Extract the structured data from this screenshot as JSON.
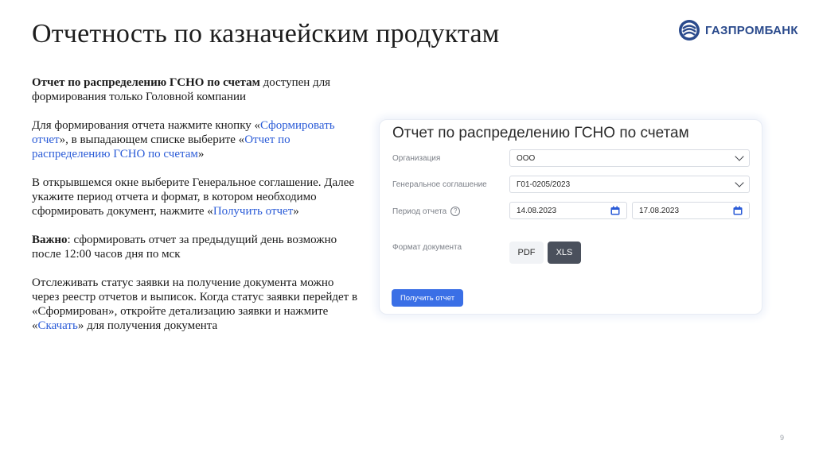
{
  "slide": {
    "title": "Отчетность по казначейским продуктам",
    "page_number": "9"
  },
  "logo": {
    "text": "ГАЗПРОМБАНК"
  },
  "instructions": {
    "p1_bold": "Отчет по распределению ГСНО по счетам",
    "p1_rest": " доступен для формирования только Головной компании",
    "p2_a": "Для формирования отчета нажмите кнопку «",
    "p2_link1": "Сформировать отчет",
    "p2_b": "», в выпадающем списке выберите «",
    "p2_link2": "Отчет по распределению ГСНО по счетам",
    "p2_c": "»",
    "p3_a": "В открывшемся окне выберите Генеральное соглашение. Далее укажите период отчета и формат, в котором необходимо сформировать документ, нажмите «",
    "p3_link": "Получить отчет",
    "p3_b": "»",
    "p4_bold": "Важно",
    "p4_rest": ": сформировать отчет за предыдущий день возможно после 12:00 часов дня по мск",
    "p5_a": "Отслеживать статус заявки на получение документа можно через реестр отчетов и выписок. Когда статус заявки перейдет в «Сформирован», откройте детализацию заявки и нажмите «",
    "p5_link": "Скачать",
    "p5_b": "» для получения документа"
  },
  "form": {
    "title": "Отчет по распределению ГСНО по счетам",
    "org_label": "Организация",
    "org_value": "ООО",
    "agreement_label": "Генеральное соглашение",
    "agreement_value": "Г01-0205/2023",
    "period_label": "Период отчета",
    "period_help": "?",
    "date_from": "14.08.2023",
    "date_to": "17.08.2023",
    "format_label": "Формат документа",
    "formats": [
      "PDF",
      "XLS"
    ],
    "selected_format": "XLS",
    "submit_label": "Получить отчет"
  },
  "colors": {
    "accent": "#3a6fe6",
    "selected_format_bg": "#4a505c",
    "link": "#2a5bd7",
    "logo": "#2a4a8c"
  }
}
